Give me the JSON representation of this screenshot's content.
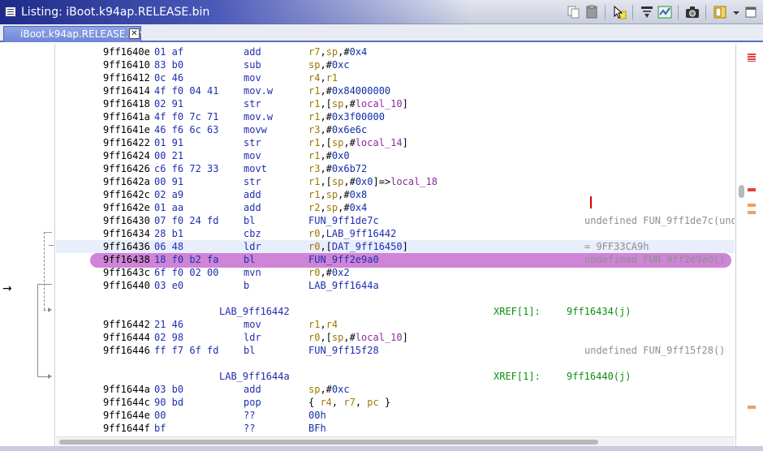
{
  "window": {
    "title": "Listing: iBoot.k94ap.RELEASE.bin"
  },
  "tab": {
    "label": "iBoot.k94ap.RELEASE.bin",
    "close_glyph": "✕"
  },
  "toolbar": {
    "icons": [
      "copy-icon",
      "paste-icon",
      "cursor-select-icon",
      "snapshot-icon",
      "field-nav-icon",
      "diff-icon",
      "camera-icon",
      "layout-icon",
      "dropdown-chevron-icon"
    ]
  },
  "margin": {
    "cursor": "→"
  },
  "rows": [
    {
      "kind": "ins",
      "addr": "9ff1640e",
      "bytes": "01 af",
      "mnem": "add",
      "ops": [
        {
          "t": "r7",
          "c": "reg"
        },
        {
          "t": ",",
          "c": "plain"
        },
        {
          "t": "sp",
          "c": "reg"
        },
        {
          "t": ",#",
          "c": "plain"
        },
        {
          "t": "0x4",
          "c": "imm"
        }
      ]
    },
    {
      "kind": "ins",
      "addr": "9ff16410",
      "bytes": "83 b0",
      "mnem": "sub",
      "ops": [
        {
          "t": "sp",
          "c": "reg"
        },
        {
          "t": ",#",
          "c": "plain"
        },
        {
          "t": "0xc",
          "c": "imm"
        }
      ]
    },
    {
      "kind": "ins",
      "addr": "9ff16412",
      "bytes": "0c 46",
      "mnem": "mov",
      "ops": [
        {
          "t": "r4",
          "c": "reg"
        },
        {
          "t": ",",
          "c": "plain"
        },
        {
          "t": "r1",
          "c": "reg"
        }
      ]
    },
    {
      "kind": "ins",
      "addr": "9ff16414",
      "bytes": "4f f0 04 41",
      "mnem": "mov.w",
      "ops": [
        {
          "t": "r1",
          "c": "reg"
        },
        {
          "t": ",#",
          "c": "plain"
        },
        {
          "t": "0x84000000",
          "c": "imm"
        }
      ]
    },
    {
      "kind": "ins",
      "addr": "9ff16418",
      "bytes": "02 91",
      "mnem": "str",
      "ops": [
        {
          "t": "r1",
          "c": "reg"
        },
        {
          "t": ",[",
          "c": "plain"
        },
        {
          "t": "sp",
          "c": "reg"
        },
        {
          "t": ",#",
          "c": "plain"
        },
        {
          "t": "local_10",
          "c": "loc"
        },
        {
          "t": "]",
          "c": "plain"
        }
      ]
    },
    {
      "kind": "ins",
      "addr": "9ff1641a",
      "bytes": "4f f0 7c 71",
      "mnem": "mov.w",
      "ops": [
        {
          "t": "r1",
          "c": "reg"
        },
        {
          "t": ",#",
          "c": "plain"
        },
        {
          "t": "0x3f00000",
          "c": "imm"
        }
      ]
    },
    {
      "kind": "ins",
      "addr": "9ff1641e",
      "bytes": "46 f6 6c 63",
      "mnem": "movw",
      "ops": [
        {
          "t": "r3",
          "c": "reg"
        },
        {
          "t": ",#",
          "c": "plain"
        },
        {
          "t": "0x6e6c",
          "c": "imm"
        }
      ]
    },
    {
      "kind": "ins",
      "addr": "9ff16422",
      "bytes": "01 91",
      "mnem": "str",
      "ops": [
        {
          "t": "r1",
          "c": "reg"
        },
        {
          "t": ",[",
          "c": "plain"
        },
        {
          "t": "sp",
          "c": "reg"
        },
        {
          "t": ",#",
          "c": "plain"
        },
        {
          "t": "local_14",
          "c": "loc"
        },
        {
          "t": "]",
          "c": "plain"
        }
      ]
    },
    {
      "kind": "ins",
      "addr": "9ff16424",
      "bytes": "00 21",
      "mnem": "mov",
      "ops": [
        {
          "t": "r1",
          "c": "reg"
        },
        {
          "t": ",#",
          "c": "plain"
        },
        {
          "t": "0x0",
          "c": "imm"
        }
      ]
    },
    {
      "kind": "ins",
      "addr": "9ff16426",
      "bytes": "c6 f6 72 33",
      "mnem": "movt",
      "ops": [
        {
          "t": "r3",
          "c": "reg"
        },
        {
          "t": ",#",
          "c": "plain"
        },
        {
          "t": "0x6b72",
          "c": "imm"
        }
      ]
    },
    {
      "kind": "ins",
      "addr": "9ff1642a",
      "bytes": "00 91",
      "mnem": "str",
      "ops": [
        {
          "t": "r1",
          "c": "reg"
        },
        {
          "t": ",[",
          "c": "plain"
        },
        {
          "t": "sp",
          "c": "reg"
        },
        {
          "t": ",#",
          "c": "plain"
        },
        {
          "t": "0x0",
          "c": "imm"
        },
        {
          "t": "]=>",
          "c": "plain"
        },
        {
          "t": "local_18",
          "c": "loc"
        }
      ]
    },
    {
      "kind": "ins",
      "addr": "9ff1642c",
      "bytes": "02 a9",
      "mnem": "add",
      "ops": [
        {
          "t": "r1",
          "c": "reg"
        },
        {
          "t": ",",
          "c": "plain"
        },
        {
          "t": "sp",
          "c": "reg"
        },
        {
          "t": ",#",
          "c": "plain"
        },
        {
          "t": "0x8",
          "c": "imm"
        }
      ]
    },
    {
      "kind": "ins",
      "addr": "9ff1642e",
      "bytes": "01 aa",
      "mnem": "add",
      "ops": [
        {
          "t": "r2",
          "c": "reg"
        },
        {
          "t": ",",
          "c": "plain"
        },
        {
          "t": "sp",
          "c": "reg"
        },
        {
          "t": ",#",
          "c": "plain"
        },
        {
          "t": "0x4",
          "c": "imm"
        }
      ]
    },
    {
      "kind": "ins",
      "addr": "9ff16430",
      "bytes": "07 f0 24 fd",
      "mnem": "bl",
      "ops": [
        {
          "t": "FUN_9ff1de7c",
          "c": "fun"
        }
      ],
      "cmt": "undefined FUN_9ff1de7c(unde"
    },
    {
      "kind": "ins",
      "addr": "9ff16434",
      "bytes": "28 b1",
      "mnem": "cbz",
      "ops": [
        {
          "t": "r0",
          "c": "reg"
        },
        {
          "t": ",",
          "c": "plain"
        },
        {
          "t": "LAB_9ff16442",
          "c": "lab"
        }
      ]
    },
    {
      "kind": "ins",
      "addr": "9ff16436",
      "bytes": "06 48",
      "mnem": "ldr",
      "ops": [
        {
          "t": "r0",
          "c": "reg"
        },
        {
          "t": ",[",
          "c": "plain"
        },
        {
          "t": "DAT_9ff16450",
          "c": "dat"
        },
        {
          "t": "]",
          "c": "plain"
        }
      ],
      "cmt": "= 9FF33CA9h",
      "hl": true
    },
    {
      "kind": "ins",
      "addr": "9ff16438",
      "bytes": "18 f0 b2 fa",
      "mnem": "bl",
      "ops": [
        {
          "t": "FUN_9ff2e9a0",
          "c": "fun"
        }
      ],
      "cmt": "undefined FUN_9ff2e9a0()",
      "sel": true
    },
    {
      "kind": "ins",
      "addr": "9ff1643c",
      "bytes": "6f f0 02 00",
      "mnem": "mvn",
      "ops": [
        {
          "t": "r0",
          "c": "reg"
        },
        {
          "t": ",#",
          "c": "plain"
        },
        {
          "t": "0x2",
          "c": "imm"
        }
      ]
    },
    {
      "kind": "ins",
      "addr": "9ff16440",
      "bytes": "03 e0",
      "mnem": "b",
      "ops": [
        {
          "t": "LAB_9ff1644a",
          "c": "lab"
        }
      ]
    },
    {
      "kind": "blank"
    },
    {
      "kind": "label",
      "label": "LAB_9ff16442",
      "xref_label": "XREF[1]:",
      "xref": "9ff16434(j)"
    },
    {
      "kind": "ins",
      "addr": "9ff16442",
      "bytes": "21 46",
      "mnem": "mov",
      "ops": [
        {
          "t": "r1",
          "c": "reg"
        },
        {
          "t": ",",
          "c": "plain"
        },
        {
          "t": "r4",
          "c": "reg"
        }
      ]
    },
    {
      "kind": "ins",
      "addr": "9ff16444",
      "bytes": "02 98",
      "mnem": "ldr",
      "ops": [
        {
          "t": "r0",
          "c": "reg"
        },
        {
          "t": ",[",
          "c": "plain"
        },
        {
          "t": "sp",
          "c": "reg"
        },
        {
          "t": ",#",
          "c": "plain"
        },
        {
          "t": "local_10",
          "c": "loc"
        },
        {
          "t": "]",
          "c": "plain"
        }
      ]
    },
    {
      "kind": "ins",
      "addr": "9ff16446",
      "bytes": "ff f7 6f fd",
      "mnem": "bl",
      "ops": [
        {
          "t": "FUN_9ff15f28",
          "c": "fun"
        }
      ],
      "cmt": "undefined FUN_9ff15f28()"
    },
    {
      "kind": "blank"
    },
    {
      "kind": "label",
      "label": "LAB_9ff1644a",
      "xref_label": "XREF[1]:",
      "xref": "9ff16440(j)"
    },
    {
      "kind": "ins",
      "addr": "9ff1644a",
      "bytes": "03 b0",
      "mnem": "add",
      "ops": [
        {
          "t": "sp",
          "c": "reg"
        },
        {
          "t": ",#",
          "c": "plain"
        },
        {
          "t": "0xc",
          "c": "imm"
        }
      ]
    },
    {
      "kind": "ins",
      "addr": "9ff1644c",
      "bytes": "90 bd",
      "mnem": "pop",
      "ops": [
        {
          "t": "{ ",
          "c": "plain"
        },
        {
          "t": "r4",
          "c": "reg"
        },
        {
          "t": ", ",
          "c": "plain"
        },
        {
          "t": "r7",
          "c": "reg"
        },
        {
          "t": ", ",
          "c": "plain"
        },
        {
          "t": "pc",
          "c": "reg"
        },
        {
          "t": " }",
          "c": "plain"
        }
      ]
    },
    {
      "kind": "ins",
      "addr": "9ff1644e",
      "bytes": "00",
      "mnem": "??",
      "ops": [
        {
          "t": "00h",
          "c": "imm"
        }
      ]
    },
    {
      "kind": "ins",
      "addr": "9ff1644f",
      "bytes": "bf",
      "mnem": "??",
      "ops": [
        {
          "t": "BFh",
          "c": "imm"
        }
      ]
    }
  ],
  "overview_colors": {
    "function": "#e04040",
    "data": "#f0a060"
  }
}
